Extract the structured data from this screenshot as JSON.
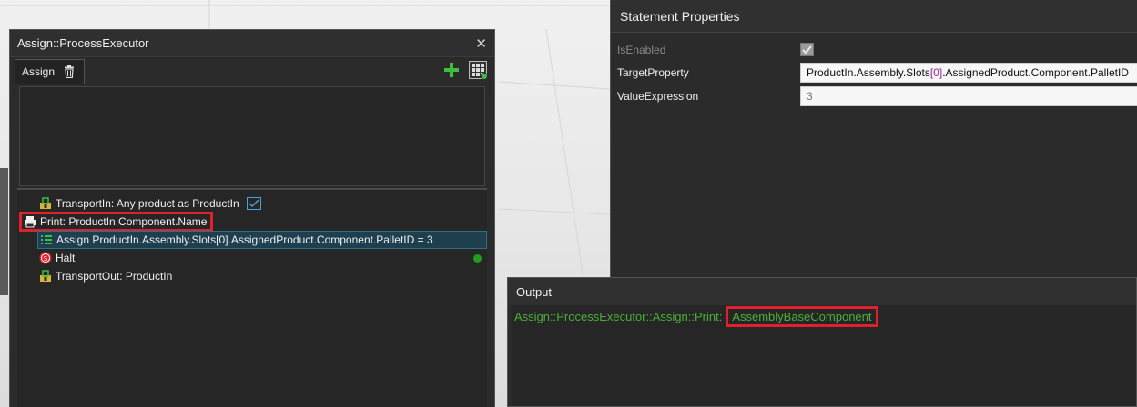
{
  "executor": {
    "title": "Assign::ProcessExecutor",
    "tab_label": "Assign",
    "statements": [
      {
        "text": "TransportIn: Any product as ProductIn",
        "icon": "transport-in-icon"
      },
      {
        "text": "Print: ProductIn.Component.Name",
        "icon": "printer-icon"
      },
      {
        "text": "Assign ProductIn.Assembly.Slots[0].AssignedProduct.Component.PalletID = 3",
        "icon": "assign-icon"
      },
      {
        "text": "Halt",
        "icon": "halt-icon"
      },
      {
        "text": "TransportOut: ProductIn",
        "icon": "transport-out-icon"
      }
    ]
  },
  "properties": {
    "title": "Statement Properties",
    "is_enabled_label": "IsEnabled",
    "is_enabled": true,
    "target_property_label": "TargetProperty",
    "target_property_prefix": "ProductIn.Assembly.Slots",
    "target_property_index": "[0]",
    "target_property_suffix": ".AssignedProduct.Component.PalletID",
    "value_expression_label": "ValueExpression",
    "value_expression": "3"
  },
  "output": {
    "title": "Output",
    "line_prefix": "Assign::ProcessExecutor::Assign::Print:",
    "line_value": "AssemblyBaseComponent"
  },
  "colors": {
    "highlight": "#e0202a",
    "output_text": "#4caf3a",
    "selected_row": "#1d3f4e",
    "add_green": "#3fbf3f"
  }
}
